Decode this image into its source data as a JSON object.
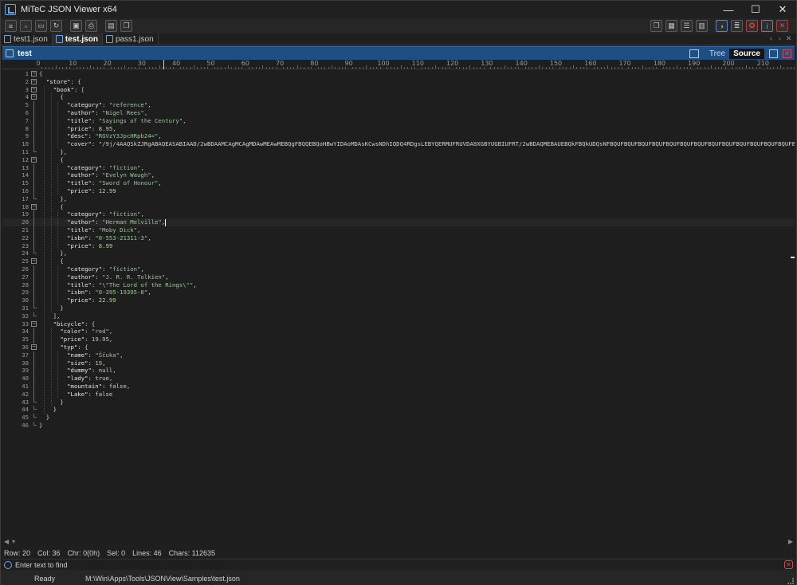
{
  "window": {
    "title": "MiTeC JSON Viewer x64",
    "minimize": "—",
    "maximize": "☐",
    "close": "✕"
  },
  "toolbar": {
    "left": [
      {
        "name": "menu-icon",
        "glyph": "≡"
      },
      {
        "name": "new-file-icon",
        "glyph": "▫"
      },
      {
        "name": "open-folder-icon",
        "glyph": "▭"
      },
      {
        "name": "refresh-icon",
        "glyph": "↻"
      },
      {
        "name": "save-icon",
        "glyph": "▣"
      },
      {
        "name": "print-icon",
        "glyph": "⎙"
      },
      {
        "name": "export-icon",
        "glyph": "▤"
      },
      {
        "name": "copy-icon",
        "glyph": "❐"
      }
    ],
    "right": [
      {
        "name": "cascade-icon",
        "glyph": "❐"
      },
      {
        "name": "grid-icon",
        "glyph": "▦"
      },
      {
        "name": "tile-horizontal-icon",
        "glyph": "☰"
      },
      {
        "name": "tile-vertical-icon",
        "glyph": "▥"
      },
      {
        "name": "theme-icon",
        "glyph": "◑"
      },
      {
        "name": "settings-icon",
        "glyph": "≣"
      },
      {
        "name": "badge-icon",
        "glyph": "✪"
      },
      {
        "name": "info-icon",
        "glyph": "i"
      },
      {
        "name": "exit-icon",
        "glyph": "✕"
      }
    ]
  },
  "tabs": [
    {
      "label": "test1.json",
      "active": false
    },
    {
      "label": "test.json",
      "active": true
    },
    {
      "label": "pass1.json",
      "active": false
    }
  ],
  "tab_nav": {
    "prev": "‹",
    "next": "›",
    "close": "✕"
  },
  "document": {
    "title": "test",
    "view_tree": "Tree",
    "view_source": "Source",
    "active_view": "Source"
  },
  "ruler": {
    "labels": [
      "0",
      "10",
      "20",
      "30",
      "40",
      "50",
      "60",
      "70",
      "80",
      "90",
      "100",
      "110",
      "120",
      "130",
      "140",
      "150",
      "160",
      "170",
      "180",
      "190",
      "200",
      "210"
    ]
  },
  "lines": [
    {
      "n": "1",
      "text": "{"
    },
    {
      "n": "2",
      "text": "  \"store\": {"
    },
    {
      "n": "3",
      "text": "    \"book\": ["
    },
    {
      "n": "4",
      "text": "      {"
    },
    {
      "n": "5",
      "text": "        \"category\": \"reference\","
    },
    {
      "n": "6",
      "text": "        \"author\": \"Nigel Rees\","
    },
    {
      "n": "7",
      "text": "        \"title\": \"Sayings of the Century\","
    },
    {
      "n": "8",
      "text": "        \"price\": 8.95,"
    },
    {
      "n": "9",
      "text": "        \"desc\": \"RGVzY3JpcHRpb24=\","
    },
    {
      "n": "10",
      "text": "        \"cover\": \"/9j/4AAQSkZJRgABAQEASABIAAD/2wBDAAMCAgMCAgMDAwMEAwMEBQgFBQQEBQoHBwYIDAoMDAsKCwsNDhIQDQ4RDgsLEBYQERMUFRUVDA8XGBYUGBIUFRT/2wBDAQMEBAUEBQkFBQkUDQsNFBQUFBQUFBQUFBQUFBQUFBQUFBQUFBQUFBQUFBQUFBQUFBQUFBQUFBQUFBQUFBQUFBQU"
    },
    {
      "n": "11",
      "text": "      },"
    },
    {
      "n": "12",
      "text": "      {"
    },
    {
      "n": "13",
      "text": "        \"category\": \"fiction\","
    },
    {
      "n": "14",
      "text": "        \"author\": \"Evelyn Waugh\","
    },
    {
      "n": "15",
      "text": "        \"title\": \"Sword of Honour\","
    },
    {
      "n": "16",
      "text": "        \"price\": 12.99"
    },
    {
      "n": "17",
      "text": "      },"
    },
    {
      "n": "18",
      "text": "      {"
    },
    {
      "n": "19",
      "text": "        \"category\": \"fiction\","
    },
    {
      "n": "20",
      "text": "        \"author\": \"Herman Melville\","
    },
    {
      "n": "21",
      "text": "        \"title\": \"Moby Dick\","
    },
    {
      "n": "22",
      "text": "        \"isbn\": \"0-553-21311-3\","
    },
    {
      "n": "23",
      "text": "        \"price\": 8.99"
    },
    {
      "n": "24",
      "text": "      },"
    },
    {
      "n": "25",
      "text": "      {"
    },
    {
      "n": "26",
      "text": "        \"category\": \"fiction\","
    },
    {
      "n": "27",
      "text": "        \"author\": \"J. R. R. Tolkien\","
    },
    {
      "n": "28",
      "text": "        \"title\": \"\\\"The Lord of the Rings\\\"\","
    },
    {
      "n": "29",
      "text": "        \"isbn\": \"0-395-19395-8\","
    },
    {
      "n": "30",
      "text": "        \"price\": 22.99"
    },
    {
      "n": "31",
      "text": "      }"
    },
    {
      "n": "32",
      "text": "    ],"
    },
    {
      "n": "33",
      "text": "    \"bicycle\": {"
    },
    {
      "n": "34",
      "text": "      \"color\": \"red\","
    },
    {
      "n": "35",
      "text": "      \"price\": 19.95,"
    },
    {
      "n": "36",
      "text": "      \"typ\": {"
    },
    {
      "n": "37",
      "text": "        \"name\": \"Ščuka\","
    },
    {
      "n": "38",
      "text": "        \"size\": 19,"
    },
    {
      "n": "39",
      "text": "        \"dummy\": null,"
    },
    {
      "n": "40",
      "text": "        \"lady\": true,"
    },
    {
      "n": "41",
      "text": "        \"mountain\": false,"
    },
    {
      "n": "42",
      "text": "        \"Lake\": false"
    },
    {
      "n": "43",
      "text": "      }"
    },
    {
      "n": "44",
      "text": "    }"
    },
    {
      "n": "45",
      "text": "  }"
    },
    {
      "n": "46",
      "text": "}"
    }
  ],
  "current_line": "20",
  "status": {
    "row": "Row: 20",
    "col": "Col: 36",
    "chr": "Chr: 0(0h)",
    "sel": "Sel: 0",
    "lines": "Lines: 46",
    "chars": "Chars: 112635"
  },
  "find": {
    "placeholder": "Enter text to find"
  },
  "bottom": {
    "state": "Ready",
    "path": "M:\\Win\\Apps\\Tools\\JSONView\\Samples\\test.json"
  }
}
